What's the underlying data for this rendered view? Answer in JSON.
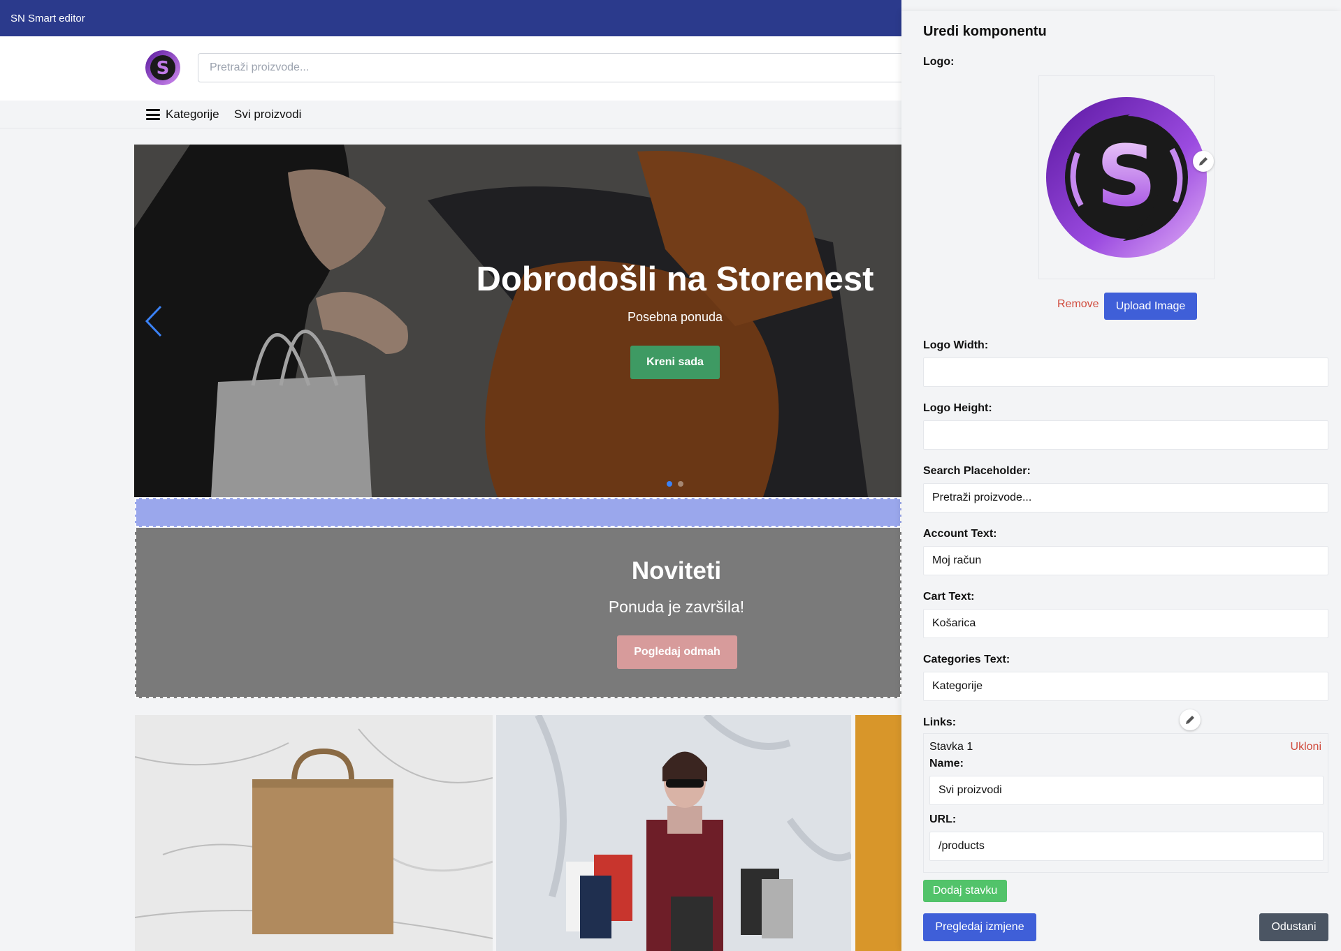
{
  "app": {
    "title": "SN Smart editor"
  },
  "header": {
    "search_placeholder": "Pretraži proizvode...",
    "nav_categories": "Kategorije",
    "nav_all_products": "Svi proizvodi"
  },
  "hero": {
    "title": "Dobrodošli na Storenest",
    "subtitle": "Posebna ponuda",
    "button": "Kreni sada",
    "slide_count": 2,
    "active_slide": 1
  },
  "promo": {
    "title": "Noviteti",
    "subtitle": "Ponuda je završila!",
    "button": "Pogledaj odmah"
  },
  "panel": {
    "title": "Uredi komponentu",
    "logo_label": "Logo:",
    "remove_label": "Remove",
    "upload_label": "Upload Image",
    "logo_width_label": "Logo Width:",
    "logo_width_value": "",
    "logo_height_label": "Logo Height:",
    "logo_height_value": "",
    "search_placeholder_label": "Search Placeholder:",
    "search_placeholder_value": "Pretraži proizvode...",
    "account_text_label": "Account Text:",
    "account_text_value": "Moj račun",
    "cart_text_label": "Cart Text:",
    "cart_text_value": "Košarica",
    "categories_text_label": "Categories Text:",
    "categories_text_value": "Kategorije",
    "links_label": "Links:",
    "links": [
      {
        "item_label": "Stavka 1",
        "remove_label": "Ukloni",
        "name_label": "Name:",
        "name_value": "Svi proizvodi",
        "url_label": "URL:",
        "url_value": "/products"
      }
    ],
    "add_item_label": "Dodaj stavku",
    "preview_label": "Pregledaj izmjene",
    "cancel_label": "Odustani"
  },
  "colors": {
    "topbar": "#2b3a8c",
    "primary": "#3f5fd8",
    "hero_button": "#3e9a63",
    "promo_button": "#d79b9b",
    "add_button": "#52c36a",
    "danger": "#d04a3c"
  }
}
